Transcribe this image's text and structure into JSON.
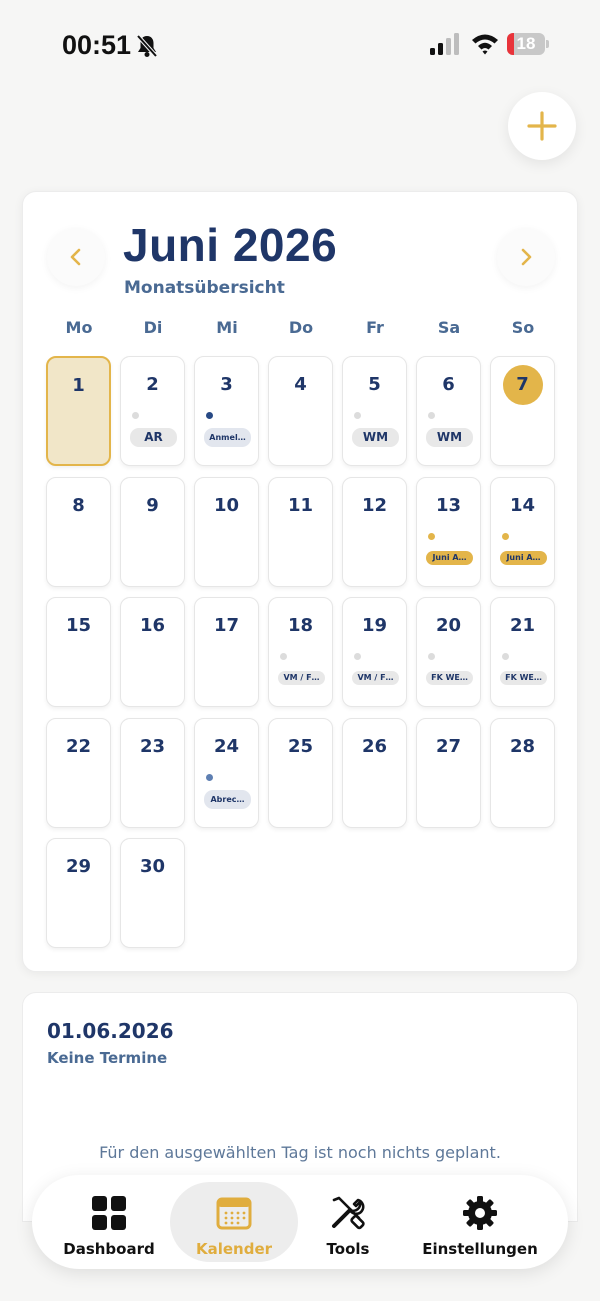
{
  "status_bar": {
    "time": "00:51",
    "battery_level": "18",
    "battery_fraction": 0.18
  },
  "calendar": {
    "month_title": "Juni 2026",
    "subtitle": "Monatsübersicht",
    "weekdays": [
      "Mo",
      "Di",
      "Mi",
      "Do",
      "Fr",
      "Sa",
      "So"
    ],
    "selected_day": 1,
    "today": 7,
    "days": [
      {
        "day": "1"
      },
      {
        "day": "2",
        "event": "AR",
        "dot": "#dcdcdc",
        "chip": "#e8e8e8"
      },
      {
        "day": "3",
        "event": "Anmel…",
        "dot": "#284a85",
        "chip": "#e2e6ee"
      },
      {
        "day": "4"
      },
      {
        "day": "5",
        "event": "WM",
        "dot": "#dcdcdc",
        "chip": "#e8e8e8"
      },
      {
        "day": "6",
        "event": "WM",
        "dot": "#dcdcdc",
        "chip": "#e8e8e8"
      },
      {
        "day": "7"
      },
      {
        "day": "8"
      },
      {
        "day": "9"
      },
      {
        "day": "10"
      },
      {
        "day": "11"
      },
      {
        "day": "12"
      },
      {
        "day": "13",
        "event": "Juni A…",
        "dot": "#e3b54a",
        "chip": "#e3b54a"
      },
      {
        "day": "14",
        "event": "Juni A…",
        "dot": "#e3b54a",
        "chip": "#e3b54a"
      },
      {
        "day": "15"
      },
      {
        "day": "16"
      },
      {
        "day": "17"
      },
      {
        "day": "18",
        "event": "VM / F…",
        "dot": "#dcdcdc",
        "chip": "#e8e8e8"
      },
      {
        "day": "19",
        "event": "VM / F…",
        "dot": "#dcdcdc",
        "chip": "#e8e8e8"
      },
      {
        "day": "20",
        "event": "FK WE…",
        "dot": "#dcdcdc",
        "chip": "#e8e8e8"
      },
      {
        "day": "21",
        "event": "FK WE…",
        "dot": "#dcdcdc",
        "chip": "#e8e8e8"
      },
      {
        "day": "22"
      },
      {
        "day": "23"
      },
      {
        "day": "24",
        "event": "Abrec…",
        "dot": "#5e7fb2",
        "chip": "#e2e6ee"
      },
      {
        "day": "25"
      },
      {
        "day": "26"
      },
      {
        "day": "27"
      },
      {
        "day": "28"
      },
      {
        "day": "29"
      },
      {
        "day": "30"
      }
    ]
  },
  "detail": {
    "date": "01.06.2026",
    "count_label": "Keine Termine",
    "empty_message": "Für den ausgewählten Tag ist noch nichts geplant."
  },
  "tabs": [
    {
      "label": "Dashboard",
      "icon": "grid-icon"
    },
    {
      "label": "Kalender",
      "icon": "calendar-icon",
      "active": true
    },
    {
      "label": "Tools",
      "icon": "tools-icon"
    },
    {
      "label": "Einstellungen",
      "icon": "gear-icon"
    }
  ],
  "colors": {
    "accent": "#e3b54a",
    "primary": "#1f3668",
    "secondary": "#4a6a93"
  }
}
